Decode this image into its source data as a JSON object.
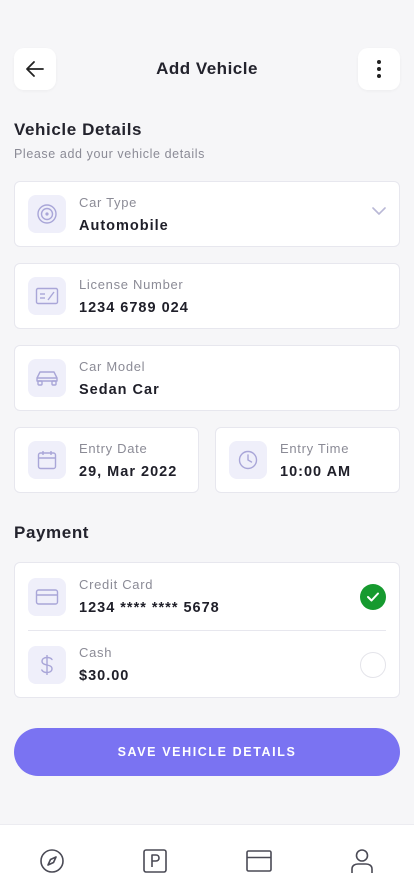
{
  "header": {
    "title": "Add Vehicle"
  },
  "vehicle_section": {
    "title": "Vehicle Details",
    "subtitle": "Please add your vehicle details"
  },
  "fields": {
    "car_type": {
      "label": "Car Type",
      "value": "Automobile",
      "icon": "tire-icon"
    },
    "license": {
      "label": "License Number",
      "value": "1234 6789 024",
      "icon": "license-card-icon"
    },
    "car_model": {
      "label": "Car Model",
      "value": "Sedan Car",
      "icon": "car-icon"
    },
    "entry_date": {
      "label": "Entry Date",
      "value": "29, Mar 2022",
      "icon": "calendar-icon"
    },
    "entry_time": {
      "label": "Entry Time",
      "value": "10:00 AM",
      "icon": "clock-icon"
    }
  },
  "payment": {
    "title": "Payment",
    "options": [
      {
        "label": "Credit Card",
        "value": "1234 **** **** 5678",
        "selected": true,
        "icon": "credit-card-icon"
      },
      {
        "label": "Cash",
        "value": "$30.00",
        "selected": false,
        "icon": "dollar-icon"
      }
    ]
  },
  "actions": {
    "save_label": "SAVE VEHICLE DETAILS"
  },
  "nav": [
    "compass-icon",
    "parking-icon",
    "wallet-icon",
    "profile-icon"
  ],
  "colors": {
    "accent": "#7a73f2",
    "icon_bg": "#efeffa",
    "success": "#169a2f",
    "icon_stroke": "#a9a6d8"
  }
}
